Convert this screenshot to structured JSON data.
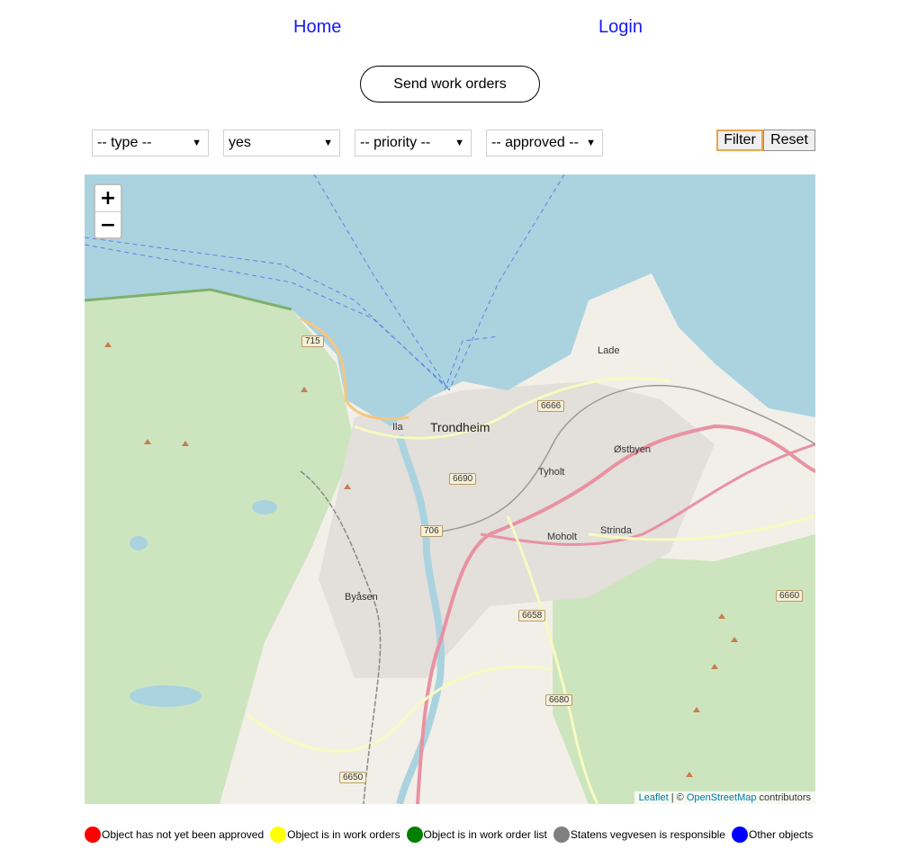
{
  "nav": {
    "home": "Home",
    "login": "Login"
  },
  "actions": {
    "send_work_orders": "Send work orders"
  },
  "filters": {
    "type": "-- type --",
    "yes_select": "yes",
    "priority": "-- priority --",
    "approved": "-- approved --",
    "filter_btn": "Filter",
    "reset_btn": "Reset"
  },
  "map": {
    "zoom_in": "+",
    "zoom_out": "−",
    "attribution": {
      "leaflet": "Leaflet",
      "sep": " | © ",
      "osm": "OpenStreetMap",
      "suffix": " contributors"
    },
    "labels": {
      "trondheim": "Trondheim",
      "ila": "Ila",
      "lade": "Lade",
      "ostbyen": "Østbyen",
      "tyholt": "Tyholt",
      "moholt": "Moholt",
      "strinda": "Strinda",
      "byasen": "Byåsen"
    },
    "shields": {
      "r715": "715",
      "r6666": "6666",
      "r6690": "6690",
      "r706": "706",
      "r6658": "6658",
      "r6660": "6660",
      "r6680": "6680",
      "r6650": "6650"
    },
    "colors": {
      "water": "#aad3df",
      "land": "#f2efe9",
      "forest": "#add19e",
      "major_road": "#e892a2",
      "secondary_road": "#f7fabf"
    }
  },
  "legend": [
    {
      "label": "Object has not yet been approved",
      "color": "#ff0000"
    },
    {
      "label": "Object is in work orders",
      "color": "#ffff00"
    },
    {
      "label": "Object is in work order list",
      "color": "#008000"
    },
    {
      "label": "Statens vegvesen is responsible",
      "color": "#808080"
    },
    {
      "label": "Other objects",
      "color": "#0000ff"
    }
  ]
}
